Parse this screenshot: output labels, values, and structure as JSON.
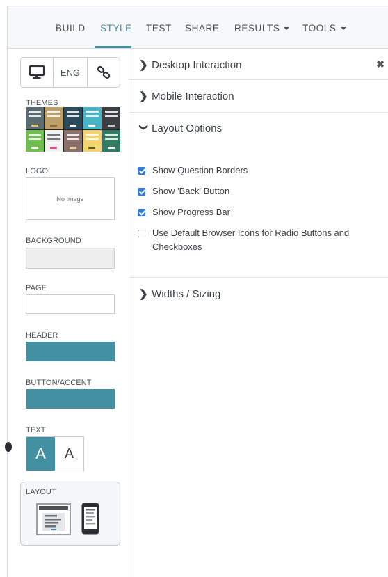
{
  "nav": {
    "build": "BUILD",
    "style": "STYLE",
    "test": "TEST",
    "share": "SHARE",
    "results": "RESULTS",
    "tools": "TOOLS",
    "active": "STYLE",
    "accent": "#3f8ea3"
  },
  "sidebar": {
    "language": "ENG",
    "themes_label": "THEMES",
    "logo_label": "LOGO",
    "logo_placeholder": "No Image",
    "background_label": "BACKGROUND",
    "page_label": "PAGE",
    "header_label": "HEADER",
    "accent_label": "BUTTON/ACCENT",
    "text_label": "TEXT",
    "text_option_light": "A",
    "text_option_dark": "A",
    "layout_label": "LAYOUT",
    "colors": {
      "background": "#eeeeee",
      "page": "#ffffff",
      "header": "#4390a2",
      "accent": "#4390a2"
    }
  },
  "panel": {
    "desktop": "Desktop Interaction",
    "mobile": "Mobile Interaction",
    "layout": "Layout Options",
    "widths": "Widths / Sizing",
    "options": [
      {
        "label": "Show Question Borders",
        "checked": true
      },
      {
        "label": "Show 'Back' Button",
        "checked": true
      },
      {
        "label": "Show Progress Bar",
        "checked": true
      },
      {
        "label": "Use Default Browser Icons for Radio Buttons and Checkboxes",
        "checked": false
      }
    ]
  }
}
